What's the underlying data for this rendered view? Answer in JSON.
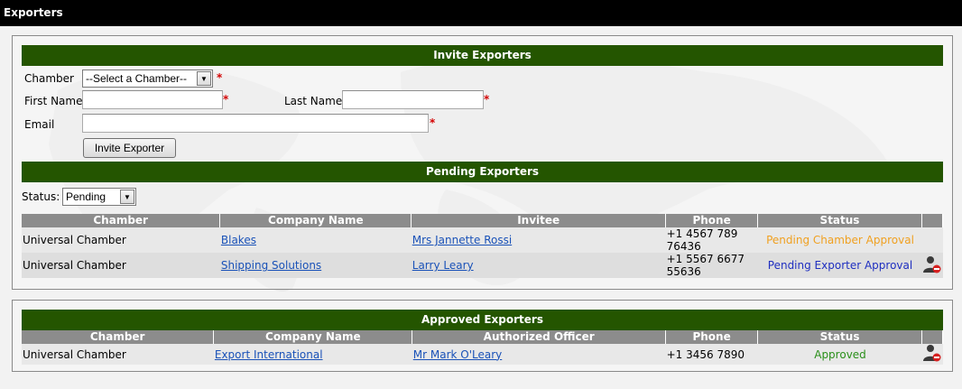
{
  "header": {
    "title": "Exporters"
  },
  "invite": {
    "section_title": "Invite Exporters",
    "chamber_label": "Chamber",
    "chamber_selected": "--Select a Chamber--",
    "first_name_label": "First Name",
    "last_name_label": "Last Name",
    "email_label": "Email",
    "required_mark": "*",
    "invite_button": "Invite Exporter"
  },
  "pending": {
    "section_title": "Pending Exporters",
    "status_label": "Status:",
    "status_selected": "Pending",
    "columns": [
      "Chamber",
      "Company Name",
      "Invitee",
      "Phone",
      "Status"
    ],
    "rows": [
      {
        "chamber": "Universal Chamber",
        "company": "Blakes",
        "invitee": "Mrs Jannette Rossi",
        "phone": "+1 4567 789 76436",
        "status": "Pending Chamber Approval"
      },
      {
        "chamber": "Universal Chamber",
        "company": "Shipping Solutions",
        "invitee": "Larry Leary",
        "phone": "+1 5567 6677 55636",
        "status": "Pending Exporter Approval"
      }
    ]
  },
  "approved": {
    "section_title": "Approved Exporters",
    "columns": [
      "Chamber",
      "Company Name",
      "Authorized Officer",
      "Phone",
      "Status"
    ],
    "rows": [
      {
        "chamber": "Universal Chamber",
        "company": "Export International",
        "officer": "Mr Mark O'Leary",
        "phone": "+1 3456 7890",
        "status": "Approved"
      }
    ]
  },
  "colors": {
    "section_bar": "#245500",
    "table_header": "#8c8c8c",
    "pending_chamber": "#f0a020",
    "pending_exporter": "#1f2fc0",
    "approved": "#2a8f1a",
    "link": "#1a52b8"
  },
  "icons": {
    "remove_user": "user-remove-icon",
    "dropdown": "chevron-down-icon"
  }
}
